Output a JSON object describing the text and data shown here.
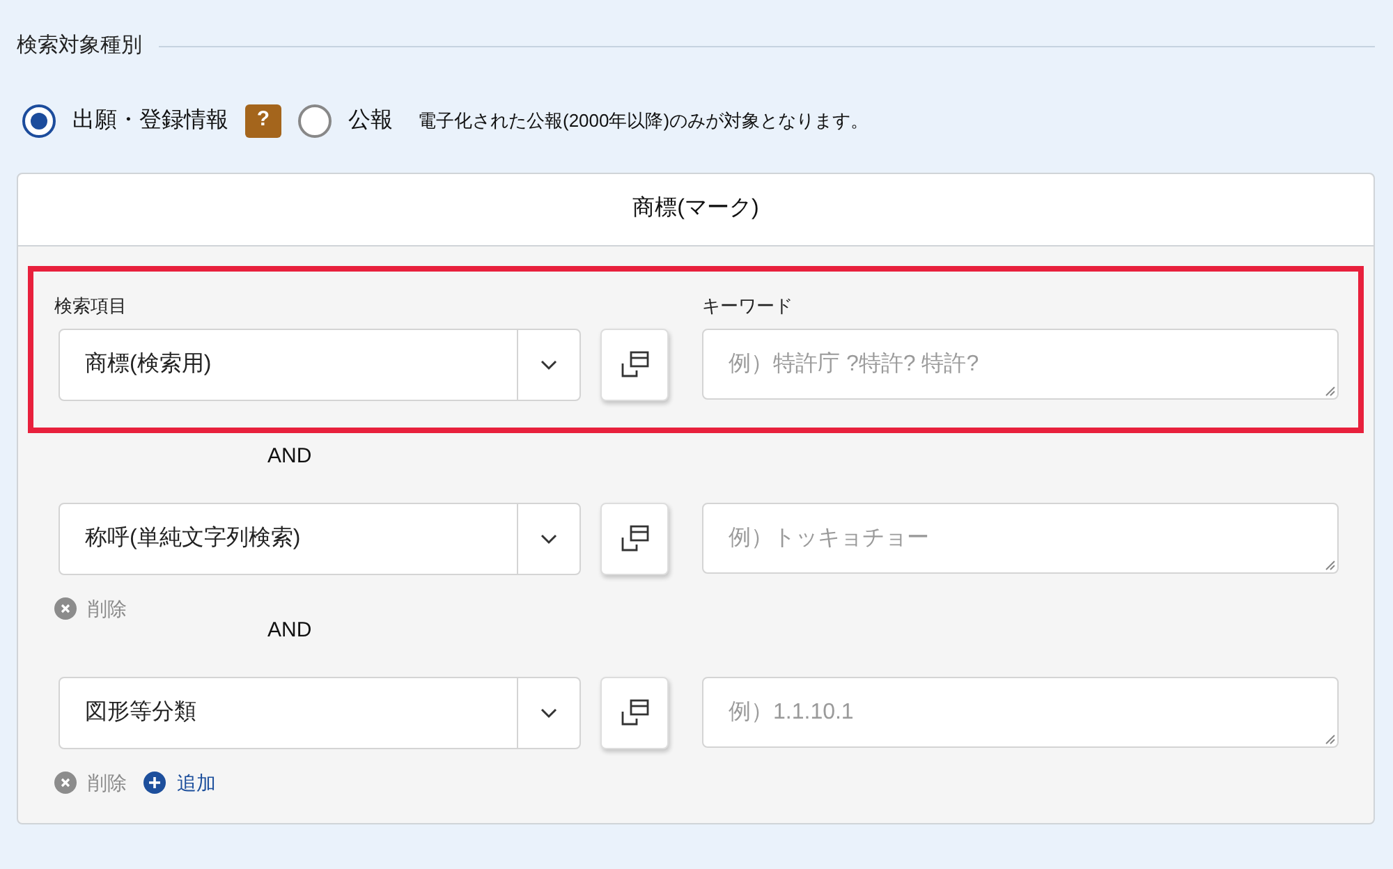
{
  "section_title": "検索対象種別",
  "target_types": [
    {
      "label": "出願・登録情報",
      "selected": true,
      "help": "?"
    },
    {
      "label": "公報",
      "selected": false,
      "note": "電子化された公報(2000年以降)のみが対象となります。"
    }
  ],
  "panel": {
    "title": "商標(マーク)",
    "field_label": "検索項目",
    "keyword_label": "キーワード",
    "rows": [
      {
        "item": "商標(検索用)",
        "placeholder": "例）特許庁 ?特許? 特許?",
        "highlighted": true,
        "connector": "AND"
      },
      {
        "item": "称呼(単純文字列検索)",
        "placeholder": "例）トッキョチョー",
        "highlighted": false,
        "actions": [
          {
            "kind": "delete",
            "label": "削除"
          }
        ],
        "connector": "AND"
      },
      {
        "item": "図形等分類",
        "placeholder": "例）1.1.10.1",
        "highlighted": false,
        "actions": [
          {
            "kind": "delete",
            "label": "削除"
          },
          {
            "kind": "add",
            "label": "追加"
          }
        ]
      }
    ]
  }
}
